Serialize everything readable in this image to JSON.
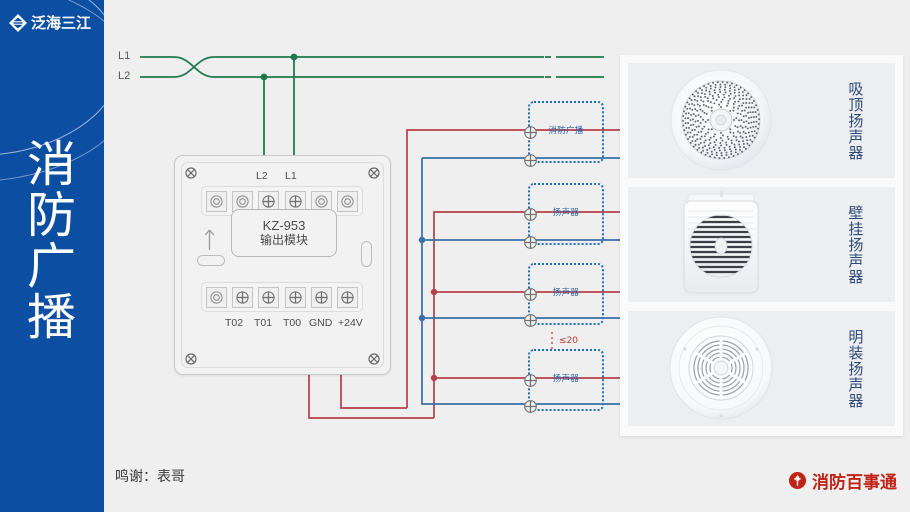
{
  "sidebar": {
    "logo_text": "泛海三江",
    "logo_icon": "diamond-logo-icon",
    "title_lines": [
      "消",
      "防",
      "广",
      "播"
    ]
  },
  "diagram": {
    "bus": {
      "l1_label": "L1",
      "l2_label": "L2",
      "wire_color_green": "#1e7a4d",
      "wire_color_red": "#b4404c",
      "wire_color_blue": "#3a6ea5"
    },
    "module": {
      "name_line1": "KZ-953",
      "name_line2": "输出模块",
      "top_labels": [
        "L2",
        "L1"
      ],
      "bottom_labels": [
        "T02",
        "T01",
        "T00",
        "GND",
        "+24V"
      ],
      "arrow_icon": "up-arrow-icon"
    },
    "limit_note": "≤20",
    "devices": [
      {
        "label": "消防广播"
      },
      {
        "label": "扬声器"
      },
      {
        "label": "扬声器"
      },
      {
        "label": "扬声器"
      }
    ]
  },
  "panels": [
    {
      "caption": "吸顶扬声器",
      "icon": "ceiling-speaker-image"
    },
    {
      "caption": "壁挂扬声器",
      "icon": "wall-speaker-image"
    },
    {
      "caption": "明装扬声器",
      "icon": "surface-speaker-image"
    }
  ],
  "footer": {
    "thanks": "鸣谢：表哥",
    "brand_text": "消防百事通",
    "brand_icon": "fire-badge-icon",
    "brand_color": "#c02418"
  }
}
